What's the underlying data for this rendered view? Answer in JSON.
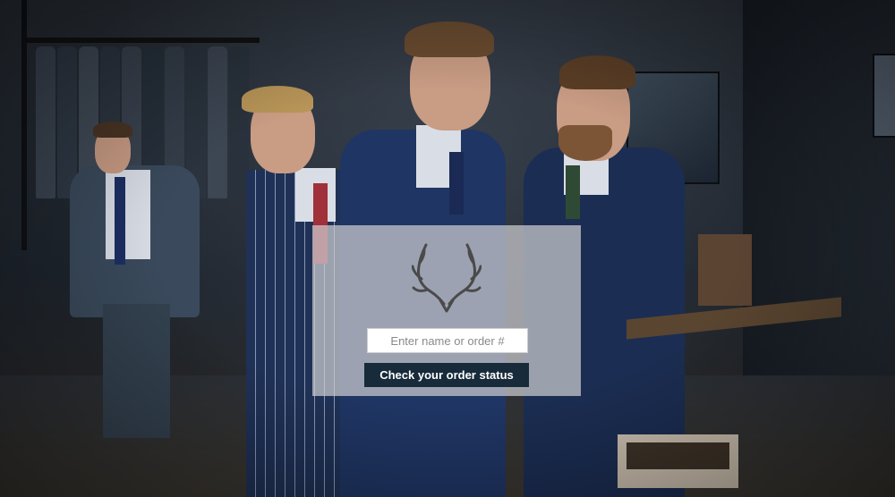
{
  "background": {
    "description_icon": "tailor-shop-photo"
  },
  "order_status": {
    "logo_icon": "antlers-icon",
    "search_placeholder": "Enter name or order #",
    "search_value": "",
    "submit_label": "Check your order status"
  },
  "colors": {
    "button_bg": "#172b3a",
    "panel_bg": "#cdcdd0"
  }
}
